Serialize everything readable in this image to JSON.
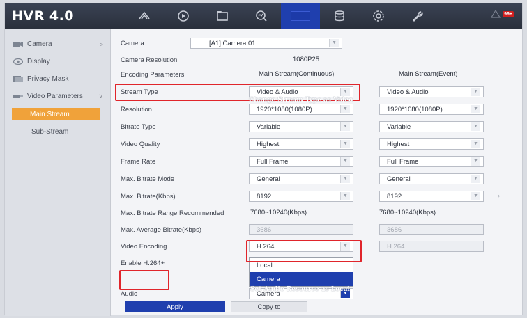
{
  "app": {
    "brand": "HVR 4.0",
    "alarm_count": "99+"
  },
  "nav_icons": [
    "live-view-icon",
    "playback-icon",
    "file-icon",
    "search-icon",
    "configuration-icon",
    "storage-icon",
    "settings-icon",
    "maintenance-icon"
  ],
  "sidebar": {
    "items": [
      {
        "label": "Camera",
        "icon": "camera-icon"
      },
      {
        "label": "Display",
        "icon": "display-icon"
      },
      {
        "label": "Privacy Mask",
        "icon": "privacy-mask-icon"
      },
      {
        "label": "Video Parameters",
        "icon": "video-parameters-icon"
      }
    ],
    "subitems": [
      {
        "label": "Main Stream"
      },
      {
        "label": "Sub-Stream"
      }
    ]
  },
  "form": {
    "camera_label": "Camera",
    "camera_value": "[A1] Camera 01",
    "resolution_label": "Camera Resolution",
    "resolution_value": "1080P25",
    "encoding_label": "Encoding Parameters",
    "col_main": "Main Stream(Continuous)",
    "col_event": "Main Stream(Event)",
    "rows": [
      {
        "label": "Stream Type",
        "main": "Video & Audio",
        "event": "Video & Audio"
      },
      {
        "label": "Resolution",
        "main": "1920*1080(1080P)",
        "event": "1920*1080(1080P)"
      },
      {
        "label": "Bitrate Type",
        "main": "Variable",
        "event": "Variable"
      },
      {
        "label": "Video Quality",
        "main": "Highest",
        "event": "Highest"
      },
      {
        "label": "Frame Rate",
        "main": "Full Frame",
        "event": "Full Frame"
      },
      {
        "label": "Max. Bitrate Mode",
        "main": "General",
        "event": "General"
      },
      {
        "label": "Max. Bitrate(Kbps)",
        "main": "8192",
        "event": "8192"
      }
    ],
    "range_label": "Max. Bitrate Range Recommended",
    "range_main": "7680~10240(Kbps)",
    "range_event": "7680~10240(Kbps)",
    "avg_label": "Max. Average Bitrate(Kbps)",
    "avg_main": "3686",
    "avg_event": "3686",
    "encoding_video_label": "Video Encoding",
    "encoding_video_main": "H.264",
    "encoding_video_event": "H.264",
    "h264plus_label": "Enable H.264+",
    "audio_label": "Audio",
    "audio_value": "Camera",
    "audio_options": [
      "Local",
      "Camera"
    ]
  },
  "annotations": {
    "stream_note": "Change Stream Type as Video",
    "audio_note": "Set Audio Resource as Local"
  },
  "buttons": {
    "apply": "Apply",
    "copy": "Copy to"
  },
  "colors": {
    "accent": "#1f3fae",
    "highlight": "#f0a23a",
    "annotation": "#e0252b",
    "topbar": "#2f3542"
  }
}
